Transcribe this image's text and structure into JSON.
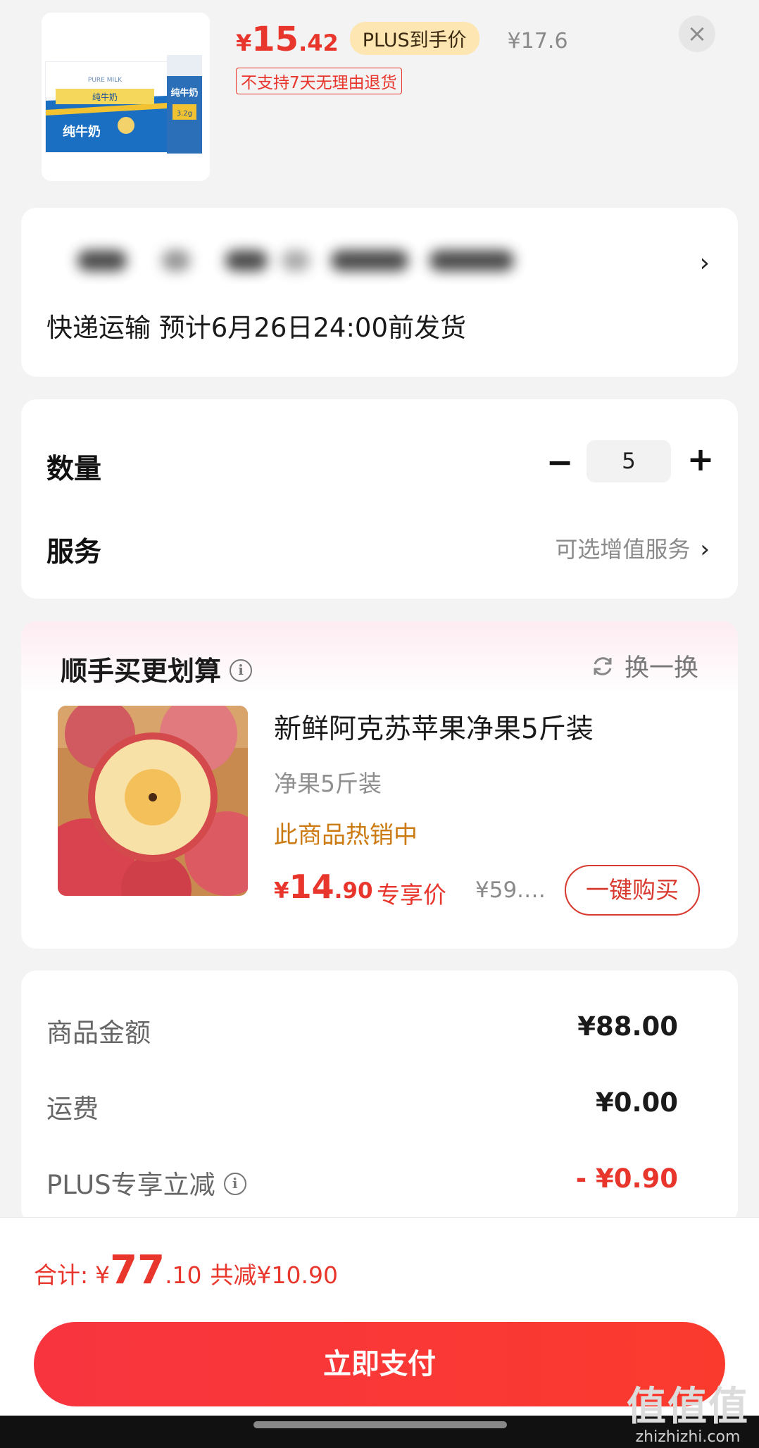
{
  "product": {
    "price_currency": "¥",
    "price_int": "15",
    "price_dec": ".42",
    "plus_badge": "PLUS到手价",
    "original_price": "¥17.6",
    "return_notice": "不支持7天无理由退货",
    "close_icon": "×",
    "image_title": "纯牛奶",
    "image_subtitle": "PURE MILK",
    "image_nutrition": "3.2g"
  },
  "address": {
    "arrow": "›",
    "shipping": "快递运输 预计6月26日24:00前发货"
  },
  "quantity": {
    "label": "数量",
    "minus": "−",
    "value": "5",
    "plus": "+"
  },
  "service": {
    "label": "服务",
    "value": "可选增值服务",
    "arrow": "›"
  },
  "recommend": {
    "title": "顺手买更划算",
    "info_icon": "i",
    "refresh_label": "换一换",
    "item_name": "新鲜阿克苏苹果净果5斤装",
    "item_spec": "净果5斤装",
    "item_hot": "此商品热销中",
    "price_currency": "¥",
    "price_int": "14",
    "price_dec": ".90",
    "price_tag": "专享价",
    "original_price": "¥59.…",
    "buy_label": "一键购买"
  },
  "summary": {
    "rows": [
      {
        "label": "商品金额",
        "value": "¥88.00"
      },
      {
        "label": "运费",
        "value": "¥0.00"
      },
      {
        "label": "PLUS专享立减",
        "value": "- ¥0.90"
      }
    ]
  },
  "bottom": {
    "total_label": "合计:",
    "total_currency": "¥",
    "total_int": "77",
    "total_dec": ".10",
    "discount": "共减¥10.90",
    "pay_label": "立即支付"
  },
  "watermark": {
    "big": "值值值",
    "small": "zhizhizhi.com"
  },
  "colors": {
    "accent_red": "#e8362d",
    "plus_gold": "#fde6b2",
    "hot_orange": "#cc7a12"
  }
}
